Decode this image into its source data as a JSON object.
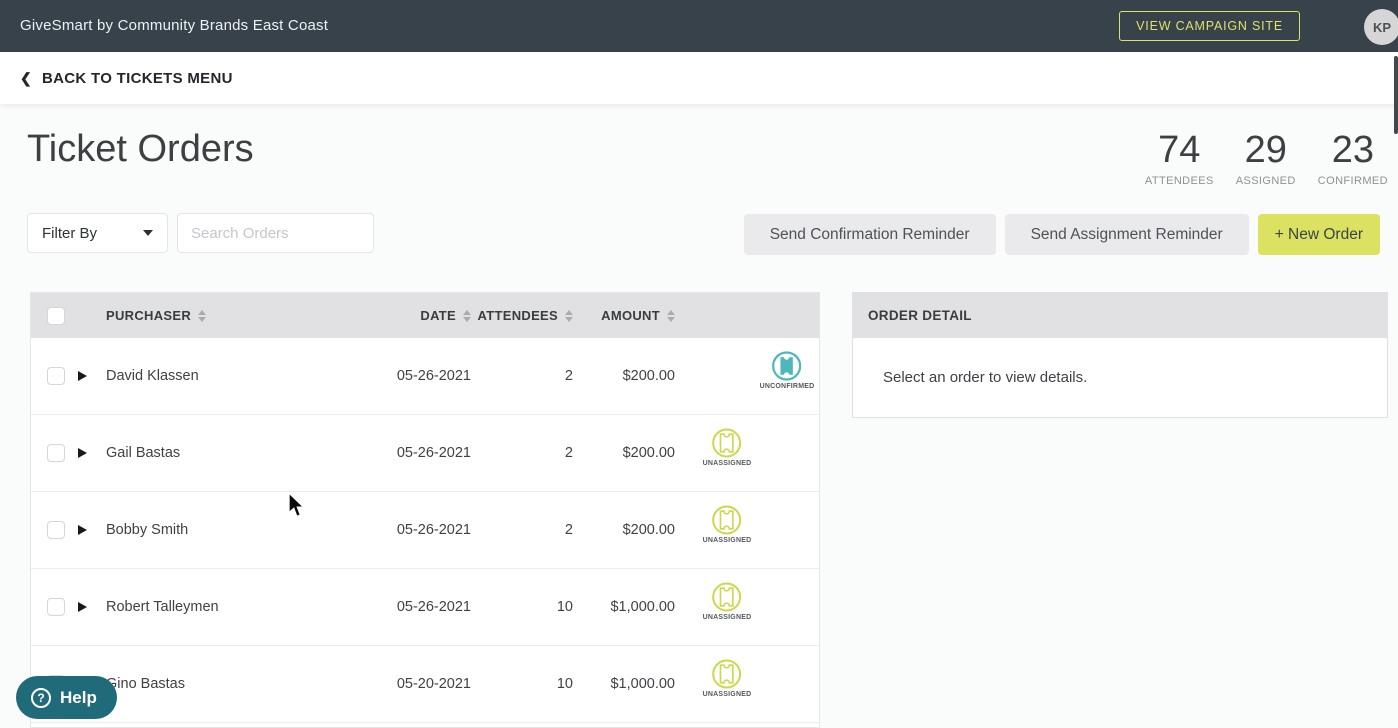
{
  "topbar": {
    "title": "GiveSmart by Community Brands East Coast",
    "view_campaign_site_label": "VIEW CAMPAIGN SITE",
    "avatar_initials": "KP"
  },
  "nav": {
    "back_link_label": "BACK TO TICKETS MENU"
  },
  "page": {
    "title": "Ticket Orders"
  },
  "stats": {
    "attendees": {
      "value": "74",
      "label": "ATTENDEES"
    },
    "assigned": {
      "value": "29",
      "label": "ASSIGNED"
    },
    "confirmed": {
      "value": "23",
      "label": "CONFIRMED"
    }
  },
  "toolbar": {
    "filter_label": "Filter By",
    "search_placeholder": "Search Orders",
    "search_value": "",
    "send_confirmation_label": "Send Confirmation Reminder",
    "send_assignment_label": "Send Assignment Reminder",
    "new_order_label": "+ New Order"
  },
  "table": {
    "headers": {
      "purchaser": "PURCHASER",
      "date": "DATE",
      "attendees": "ATTENDEES",
      "amount": "AMOUNT"
    },
    "rows": [
      {
        "purchaser": "David Klassen",
        "date": "05-26-2021",
        "attendees": "2",
        "amount": "$200.00",
        "status": "UNCONFIRMED"
      },
      {
        "purchaser": "Gail Bastas",
        "date": "05-26-2021",
        "attendees": "2",
        "amount": "$200.00",
        "status": "UNASSIGNED"
      },
      {
        "purchaser": "Bobby Smith",
        "date": "05-26-2021",
        "attendees": "2",
        "amount": "$200.00",
        "status": "UNASSIGNED"
      },
      {
        "purchaser": "Robert Talleymen",
        "date": "05-26-2021",
        "attendees": "10",
        "amount": "$1,000.00",
        "status": "UNASSIGNED"
      },
      {
        "purchaser": "Gino Bastas",
        "date": "05-20-2021",
        "attendees": "10",
        "amount": "$1,000.00",
        "status": "UNASSIGNED"
      }
    ]
  },
  "detail_panel": {
    "header": "ORDER DETAIL",
    "empty_message": "Select an order to view details."
  },
  "help": {
    "label": "Help",
    "icon_glyph": "?"
  },
  "icons": {
    "back_chevron": "❮",
    "dropdown_caret": "caret-down-triangle",
    "expand_row": "right-triangle",
    "sort": "up-down-triangles",
    "status_ticket": "ticket-in-circle"
  },
  "colors": {
    "header_dark": "#37424a",
    "accent": "#dce26a",
    "accent_btn": "#dbe160",
    "teal": "#4db7bb",
    "unassigned_green": "#cbd84c",
    "help_teal": "#1f6b79"
  }
}
